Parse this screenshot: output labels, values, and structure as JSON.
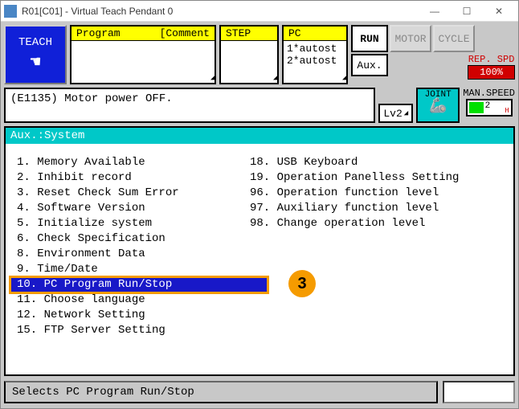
{
  "window": {
    "title": "R01[C01] - Virtual Teach Pendant 0"
  },
  "top": {
    "teach": "TEACH",
    "program_header_left": "Program",
    "program_header_right": "[Comment",
    "step_header": "STEP",
    "pc_header": "PC",
    "pc_lines": [
      "1*autost",
      "2*autost"
    ],
    "run": "RUN",
    "motor": "MOTOR",
    "cycle": "CYCLE",
    "aux": "Aux.",
    "repspd_label": "REP. SPD",
    "repspd_value": "100%"
  },
  "mid": {
    "message": "(E1135) Motor power OFF.",
    "lv2": "Lv2",
    "joint": "JOINT",
    "manspeed_label": "MAN.SPEED",
    "manspeed_value": "2"
  },
  "main": {
    "header": "Aux.:System",
    "col1": [
      {
        "n": "1.",
        "t": "Memory Available"
      },
      {
        "n": "2.",
        "t": "Inhibit record"
      },
      {
        "n": "3.",
        "t": "Reset Check Sum Error"
      },
      {
        "n": "4.",
        "t": "Software Version"
      },
      {
        "n": "5.",
        "t": "Initialize system"
      },
      {
        "n": "6.",
        "t": "Check Specification"
      },
      {
        "n": "8.",
        "t": "Environment Data"
      },
      {
        "n": "9.",
        "t": "Time/Date"
      },
      {
        "n": "10.",
        "t": "PC Program Run/Stop",
        "sel": true
      },
      {
        "n": "11.",
        "t": "Choose language"
      },
      {
        "n": "12.",
        "t": "Network Setting"
      },
      {
        "n": "15.",
        "t": "FTP Server Setting"
      }
    ],
    "col2": [
      {
        "n": "18.",
        "t": "USB Keyboard"
      },
      {
        "n": "19.",
        "t": "Operation Panelless Setting"
      },
      {
        "n": "96.",
        "t": "Operation function level"
      },
      {
        "n": "97.",
        "t": "Auxiliary function level"
      },
      {
        "n": "98.",
        "t": "Change operation level"
      }
    ],
    "annotation": "3"
  },
  "bottom": {
    "hint": "Selects PC Program Run/Stop"
  }
}
